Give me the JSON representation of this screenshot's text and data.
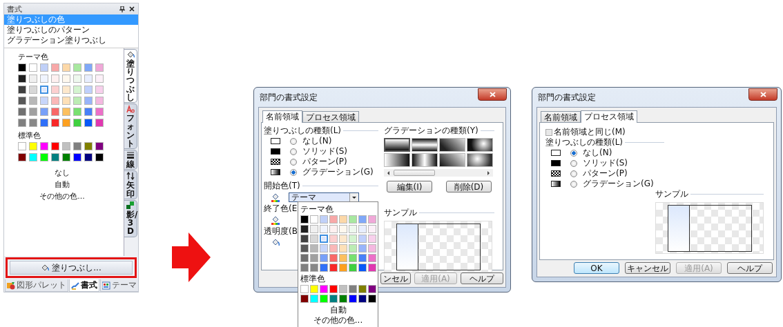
{
  "format_panel": {
    "title": "書式",
    "fill_options": [
      {
        "label": "塗りつぶしの色",
        "selected": true
      },
      {
        "label": "塗りつぶしのパターン",
        "selected": false
      },
      {
        "label": "グラデーション塗りつぶし",
        "selected": false
      }
    ],
    "theme_heading": "テーマ色",
    "theme_colors": [
      [
        {
          "color": "#000000",
          "selected": false
        },
        {
          "color": "#ffffff",
          "selected": false
        },
        {
          "color": "#c0d0f8",
          "selected": false
        },
        {
          "color": "#f8a8a8",
          "selected": false
        },
        {
          "color": "#fcd8a8",
          "selected": false
        },
        {
          "color": "#a8e8a0",
          "selected": false
        },
        {
          "color": "#80a8f8",
          "selected": false
        },
        {
          "color": "#f0a8d8",
          "selected": false
        }
      ],
      [
        {
          "color": "#202020",
          "selected": false
        },
        {
          "color": "#f0f0f0",
          "selected": false
        },
        {
          "color": "#f0f4fe",
          "selected": false
        },
        {
          "color": "#fef0f0",
          "selected": false
        },
        {
          "color": "#fef8ee",
          "selected": false
        },
        {
          "color": "#eef8ee",
          "selected": false
        },
        {
          "color": "#e8eefe",
          "selected": false
        },
        {
          "color": "#fcf0f8",
          "selected": false
        }
      ],
      [
        {
          "color": "#404040",
          "selected": false
        },
        {
          "color": "#d8d8d8",
          "selected": false
        },
        {
          "color": "#dce6fc",
          "selected": true
        },
        {
          "color": "#fcd0d0",
          "selected": false
        },
        {
          "color": "#fde8cc",
          "selected": false
        },
        {
          "color": "#d4f4d0",
          "selected": false
        },
        {
          "color": "#c0d0fc",
          "selected": false
        },
        {
          "color": "#f8d0ec",
          "selected": false
        }
      ],
      [
        {
          "color": "#585858",
          "selected": false
        },
        {
          "color": "#b8b8b8",
          "selected": false
        },
        {
          "color": "#c8d6fa",
          "selected": false
        },
        {
          "color": "#fab8b8",
          "selected": false
        },
        {
          "color": "#fde0b8",
          "selected": false
        },
        {
          "color": "#bcecb4",
          "selected": false
        },
        {
          "color": "#98b4fa",
          "selected": false
        },
        {
          "color": "#f4b8e0",
          "selected": false
        }
      ],
      [
        {
          "color": "#707070",
          "selected": false
        },
        {
          "color": "#a0a0a0",
          "selected": false
        },
        {
          "color": "#78a0f8",
          "selected": false
        },
        {
          "color": "#f86868",
          "selected": false
        },
        {
          "color": "#fcc060",
          "selected": false
        },
        {
          "color": "#78e070",
          "selected": false
        },
        {
          "color": "#4880f8",
          "selected": false
        },
        {
          "color": "#ec70c8",
          "selected": false
        }
      ],
      [
        {
          "color": "#808080",
          "selected": false
        },
        {
          "color": "#888888",
          "selected": false
        },
        {
          "color": "#3070f8",
          "selected": false
        },
        {
          "color": "#f82828",
          "selected": false
        },
        {
          "color": "#fca020",
          "selected": false
        },
        {
          "color": "#40d040",
          "selected": false
        },
        {
          "color": "#0858f8",
          "selected": false
        },
        {
          "color": "#e038b0",
          "selected": false
        }
      ]
    ],
    "standard_heading": "標準色",
    "standard_colors": [
      [
        {
          "color": "#ffffff",
          "selected": false
        },
        {
          "color": "#ffff00",
          "selected": false
        },
        {
          "color": "#ff00ff",
          "selected": false
        },
        {
          "color": "#ff0000",
          "selected": false
        },
        {
          "color": "#c0c0c0",
          "selected": false
        },
        {
          "color": "#808080",
          "selected": false
        },
        {
          "color": "#808000",
          "selected": false
        },
        {
          "color": "#800080",
          "selected": false
        }
      ],
      [
        {
          "color": "#800000",
          "selected": false
        },
        {
          "color": "#00ffff",
          "selected": false
        },
        {
          "color": "#00ff00",
          "selected": false
        },
        {
          "color": "#008080",
          "selected": false
        },
        {
          "color": "#008000",
          "selected": false
        },
        {
          "color": "#0000ff",
          "selected": false
        },
        {
          "color": "#000080",
          "selected": false
        },
        {
          "color": "#000000",
          "selected": false
        }
      ]
    ],
    "extra_options": [
      "なし",
      "自動",
      "その他の色..."
    ],
    "side_tabs": [
      {
        "kind": "fill",
        "label": "塗りつぶし",
        "selected": true
      },
      {
        "kind": "font",
        "label": "フォント",
        "selected": false
      },
      {
        "kind": "line",
        "label": "線",
        "selected": false
      },
      {
        "kind": "arrow",
        "label": "矢印",
        "selected": false
      },
      {
        "kind": "shadow",
        "label": "影/3D",
        "selected": false
      }
    ],
    "fill_button": {
      "label": "塗りつぶし...",
      "highlighted": true
    },
    "bottom_tabs": [
      {
        "kind": "shapes",
        "label": "図形パレット",
        "selected": false
      },
      {
        "kind": "format",
        "label": "書式",
        "selected": true
      },
      {
        "kind": "theme",
        "label": "テーマ",
        "selected": false
      }
    ]
  },
  "name_area_dialog": {
    "title": "部門の書式設定",
    "tabs": [
      {
        "label": "名前領域",
        "selected": true
      },
      {
        "label": "プロセス領域",
        "selected": false
      }
    ],
    "fill_type_heading": "塗りつぶしの種類(L)",
    "fill_types": [
      {
        "kind": "none",
        "label": "なし(N)",
        "selected": false
      },
      {
        "kind": "solid",
        "label": "ソリッド(S)",
        "selected": false
      },
      {
        "kind": "pattern",
        "label": "パターン(P)",
        "selected": false
      },
      {
        "kind": "gradient",
        "label": "グラデーション(G)",
        "selected": true
      }
    ],
    "start_color_label": "開始色(T)",
    "start_color_value": "テーマ",
    "end_color_label": "終了色(E",
    "transparency_label": "透明度(B",
    "gradient_heading": "グラデーションの種類(Y)",
    "gradient_types": [
      {
        "selected": true
      },
      {
        "selected": false
      },
      {
        "selected": false
      },
      {
        "selected": false
      },
      {
        "selected": false
      },
      {
        "selected": false
      },
      {
        "selected": false
      },
      {
        "selected": false
      }
    ],
    "gradient_buttons": [
      "編集(I)",
      "削除(D)"
    ],
    "sample_heading": "サンプル",
    "buttons": [
      {
        "label": "ンセル",
        "disabled": false,
        "default": false
      },
      {
        "label": "適用(A)",
        "disabled": true,
        "default": false
      },
      {
        "label": "ヘルプ",
        "disabled": false,
        "default": false
      }
    ]
  },
  "color_dropdown": {
    "theme_heading": "テーマ色",
    "theme_colors": [
      [
        {
          "color": "#000000",
          "selected": false
        },
        {
          "color": "#ffffff",
          "selected": false
        },
        {
          "color": "#c0d0f8",
          "selected": false
        },
        {
          "color": "#f8a8a8",
          "selected": false
        },
        {
          "color": "#fcd8a8",
          "selected": false
        },
        {
          "color": "#a8e8a0",
          "selected": false
        },
        {
          "color": "#80a8f8",
          "selected": false
        },
        {
          "color": "#f0a8d8",
          "selected": false
        }
      ],
      [
        {
          "color": "#202020",
          "selected": false
        },
        {
          "color": "#f0f0f0",
          "selected": false
        },
        {
          "color": "#f0f4fe",
          "selected": false
        },
        {
          "color": "#fef0f0",
          "selected": false
        },
        {
          "color": "#fef8ee",
          "selected": false
        },
        {
          "color": "#eef8ee",
          "selected": false
        },
        {
          "color": "#e8eefe",
          "selected": false
        },
        {
          "color": "#fcf0f8",
          "selected": false
        }
      ],
      [
        {
          "color": "#404040",
          "selected": false
        },
        {
          "color": "#d8d8d8",
          "selected": false
        },
        {
          "color": "#dce6fc",
          "selected": true
        },
        {
          "color": "#fcd0d0",
          "selected": false
        },
        {
          "color": "#fde8cc",
          "selected": false
        },
        {
          "color": "#d4f4d0",
          "selected": false
        },
        {
          "color": "#c0d0fc",
          "selected": false
        },
        {
          "color": "#f8d0ec",
          "selected": false
        }
      ],
      [
        {
          "color": "#585858",
          "selected": false
        },
        {
          "color": "#b8b8b8",
          "selected": false
        },
        {
          "color": "#c8d6fa",
          "selected": false
        },
        {
          "color": "#fab8b8",
          "selected": false
        },
        {
          "color": "#fde0b8",
          "selected": false
        },
        {
          "color": "#bcecb4",
          "selected": false
        },
        {
          "color": "#98b4fa",
          "selected": false
        },
        {
          "color": "#f4b8e0",
          "selected": false
        }
      ],
      [
        {
          "color": "#707070",
          "selected": false
        },
        {
          "color": "#a0a0a0",
          "selected": false
        },
        {
          "color": "#78a0f8",
          "selected": false
        },
        {
          "color": "#f86868",
          "selected": false
        },
        {
          "color": "#fcc060",
          "selected": false
        },
        {
          "color": "#78e070",
          "selected": false
        },
        {
          "color": "#4880f8",
          "selected": false
        },
        {
          "color": "#ec70c8",
          "selected": false
        }
      ],
      [
        {
          "color": "#808080",
          "selected": false
        },
        {
          "color": "#888888",
          "selected": false
        },
        {
          "color": "#3070f8",
          "selected": false
        },
        {
          "color": "#f82828",
          "selected": false
        },
        {
          "color": "#fca020",
          "selected": false
        },
        {
          "color": "#40d040",
          "selected": false
        },
        {
          "color": "#0858f8",
          "selected": false
        },
        {
          "color": "#e038b0",
          "selected": false
        }
      ]
    ],
    "standard_heading": "標準色",
    "standard_colors": [
      [
        {
          "color": "#ffffff",
          "selected": false
        },
        {
          "color": "#ffff00",
          "selected": false
        },
        {
          "color": "#ff00ff",
          "selected": false
        },
        {
          "color": "#ff0000",
          "selected": false
        },
        {
          "color": "#c0c0c0",
          "selected": false
        },
        {
          "color": "#808080",
          "selected": false
        },
        {
          "color": "#808000",
          "selected": false
        },
        {
          "color": "#800080",
          "selected": false
        }
      ],
      [
        {
          "color": "#800000",
          "selected": false
        },
        {
          "color": "#00ffff",
          "selected": false
        },
        {
          "color": "#00ff00",
          "selected": false
        },
        {
          "color": "#008080",
          "selected": false
        },
        {
          "color": "#008000",
          "selected": false
        },
        {
          "color": "#0000ff",
          "selected": false
        },
        {
          "color": "#000080",
          "selected": false
        },
        {
          "color": "#000000",
          "selected": false
        }
      ]
    ],
    "options": [
      "自動",
      "その他の色..."
    ]
  },
  "process_area_dialog": {
    "title": "部門の書式設定",
    "tabs": [
      {
        "label": "名前領域",
        "selected": false
      },
      {
        "label": "プロセス領域",
        "selected": true
      }
    ],
    "same_as_name_area": {
      "label": "名前領域と同じ(M)",
      "checked": false
    },
    "fill_type_heading": "塗りつぶしの種類(L)",
    "fill_types": [
      {
        "kind": "none",
        "label": "なし(N)",
        "selected": true
      },
      {
        "kind": "solid",
        "label": "ソリッド(S)",
        "selected": false
      },
      {
        "kind": "pattern",
        "label": "パターン(P)",
        "selected": false
      },
      {
        "kind": "gradient",
        "label": "グラデーション(G)",
        "selected": false
      }
    ],
    "sample_heading": "サンプル",
    "buttons": [
      {
        "label": "OK",
        "disabled": false,
        "default": true
      },
      {
        "label": "キャンセル",
        "disabled": false,
        "default": false
      },
      {
        "label": "適用(A)",
        "disabled": true,
        "default": false
      },
      {
        "label": "ヘルプ",
        "disabled": false,
        "default": false
      }
    ]
  }
}
